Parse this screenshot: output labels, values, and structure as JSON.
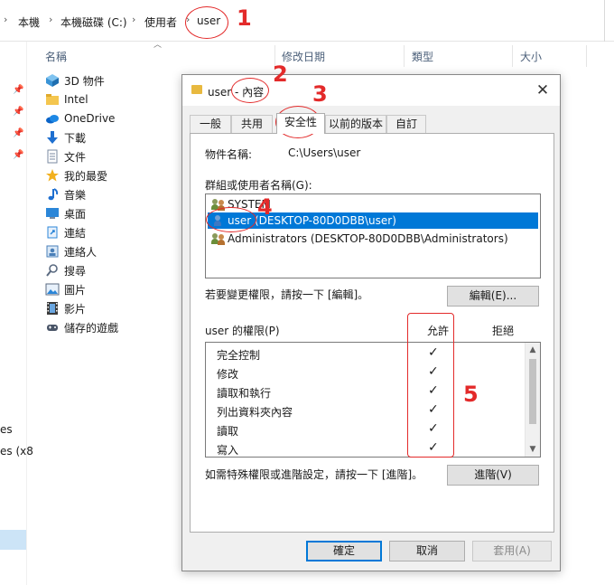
{
  "breadcrumb": {
    "items": [
      "本機",
      "本機磁碟 (C:)",
      "使用者",
      "user"
    ],
    "separator": "›"
  },
  "explorer": {
    "columns": [
      "名稱",
      "修改日期",
      "類型",
      "大小"
    ],
    "quick_access": [
      {
        "label": "3D 物件",
        "icon": "cube-icon"
      },
      {
        "label": "Intel",
        "icon": "folder-icon"
      },
      {
        "label": "OneDrive",
        "icon": "cloud-icon"
      },
      {
        "label": "下載",
        "icon": "download-icon"
      },
      {
        "label": "文件",
        "icon": "document-icon"
      },
      {
        "label": "我的最愛",
        "icon": "star-icon"
      },
      {
        "label": "音樂",
        "icon": "music-icon"
      },
      {
        "label": "桌面",
        "icon": "desktop-icon"
      },
      {
        "label": "連結",
        "icon": "link-icon"
      },
      {
        "label": "連絡人",
        "icon": "contacts-icon"
      },
      {
        "label": "搜尋",
        "icon": "search-icon"
      },
      {
        "label": "圖片",
        "icon": "pictures-icon"
      },
      {
        "label": "影片",
        "icon": "video-icon"
      },
      {
        "label": "儲存的遊戲",
        "icon": "game-icon"
      }
    ],
    "nav_truncated": [
      "es",
      "es (x8"
    ]
  },
  "dialog": {
    "title": "user - 內容",
    "close_glyph": "✕",
    "tabs": [
      "一般",
      "共用",
      "安全性",
      "以前的版本",
      "自訂"
    ],
    "active_tab": "安全性",
    "object_name_label": "物件名稱:",
    "object_name_value": "C:\\Users\\user",
    "groups_label": "群組或使用者名稱(G):",
    "groups": [
      {
        "name": "SYSTEM",
        "selected": false
      },
      {
        "name": "user (DESKTOP-80D0DBB\\user)",
        "selected": true
      },
      {
        "name": "Administrators (DESKTOP-80D0DBB\\Administrators)",
        "selected": false
      }
    ],
    "edit_hint": "若要變更權限，請按一下 [編輯]。",
    "edit_button": "編輯(E)...",
    "permissions_label": "user 的權限(P)",
    "allow_header": "允許",
    "deny_header": "拒絕",
    "permissions": [
      {
        "name": "完全控制",
        "allow": true
      },
      {
        "name": "修改",
        "allow": true
      },
      {
        "name": "讀取和執行",
        "allow": true
      },
      {
        "name": "列出資料夾內容",
        "allow": true
      },
      {
        "name": "讀取",
        "allow": true
      },
      {
        "name": "寫入",
        "allow": true
      }
    ],
    "check_glyph": "✓",
    "advanced_hint": "如需特殊權限或進階設定，請按一下 [進階]。",
    "advanced_button": "進階(V)",
    "ok_button": "確定",
    "cancel_button": "取消",
    "apply_button": "套用(A)"
  },
  "annotations": [
    "1",
    "2",
    "3",
    "4",
    "5"
  ],
  "colors": {
    "annotation": "#e32a2a",
    "selection": "#0078d7",
    "folder": "#e8b93f"
  }
}
